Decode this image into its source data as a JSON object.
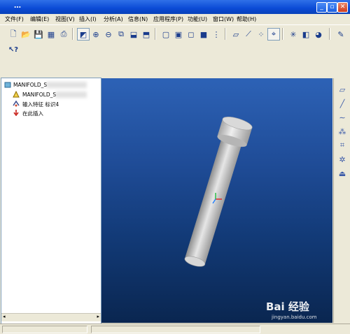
{
  "window": {
    "title": "…"
  },
  "menubar": {
    "items": [
      {
        "label": "文件(F)"
      },
      {
        "label": "编辑(E)"
      },
      {
        "label": "视图(V)"
      },
      {
        "label": "插入(I)"
      },
      {
        "label": "分析(A)"
      },
      {
        "label": "信息(N)"
      },
      {
        "label": "应用程序(P)"
      },
      {
        "label": "功能(U)"
      },
      {
        "label": "窗口(W)"
      },
      {
        "label": "帮助(H)"
      }
    ]
  },
  "toolbar": {
    "context_help_icon": "what's-this-icon"
  },
  "model_tree": {
    "root": "MANIFOLD_S",
    "items": [
      {
        "label": "MANIFOLD_S",
        "icon": "part-icon"
      },
      {
        "label": "输入特征 标识4",
        "icon": "import-feature-icon"
      },
      {
        "label": "在此插入",
        "icon": "insert-here-arrow-icon"
      }
    ]
  },
  "watermark": {
    "brand": "Bai 经验",
    "url": "jingyan.baidu.com"
  },
  "colors": {
    "viewport_top": "#2d62b6",
    "viewport_bottom": "#0a2650",
    "part_gray": "#c9c9c9",
    "title_blue": "#0a4ad6"
  }
}
